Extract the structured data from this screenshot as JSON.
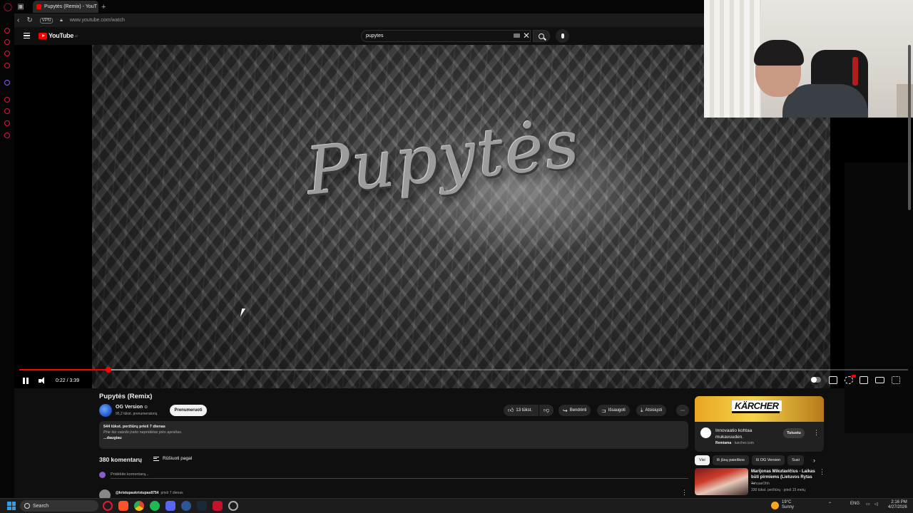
{
  "browser": {
    "tab_title": "Pupytės (Remix) - YouT",
    "url": "www.youtube.com/watch",
    "vpn_label": "VPN",
    "new_tab_icon": "plus-icon"
  },
  "youtube": {
    "logo_text": "YouTube",
    "logo_region": "LT",
    "search_value": "pupytes"
  },
  "video": {
    "overlay_title": "Pupytės",
    "current_time": "0:22",
    "duration": "3:39",
    "time_display": "0:22 / 3:39",
    "progress_fraction": 0.1,
    "buffer_fraction": 0.25,
    "title": "Pupytės (Remix)"
  },
  "channel": {
    "name": "OG Version",
    "subscribers": "95,2 tūkst. prenumeratorių",
    "subscribe_label": "Prenumeruoti"
  },
  "actions": {
    "likes": "13 tūkst.",
    "share": "Bendrinti",
    "save": "Išsaugoti",
    "download": "Atsisiųsti"
  },
  "description": {
    "views_line": "544 tūkst. peržiūrų  prieš 7 dienas",
    "text": "Prie šio vaizdo įrašo nepridėtas joks aprašas.",
    "more": "...daugiau"
  },
  "comments": {
    "count": "380 komentarų",
    "sort_label": "Rūšiuoti pagal",
    "add_placeholder": "Pridėkite komentarą...",
    "first_author": "@kristupaskristupas8754",
    "first_time": "prieš 7 dienas"
  },
  "ad": {
    "brand": "KÄRCHER",
    "headline_line1": "Innovaatio kohtaa",
    "headline_line2": "mukavuuden.",
    "sponsor_label": "Remiama",
    "domain": "karcher.com",
    "cta": "Tutustu"
  },
  "chips": [
    "Visi",
    "Iš jūsų paieškos",
    "Iš OG Version",
    "Susi"
  ],
  "recommendation": {
    "title": "Marijonas Mikutavičius - Laikas būti pirmiems (Lietuvos Rytas ...",
    "channel": "TohuaeOhh",
    "meta": "330 tūkst. peržiūrų · prieš 15 metų",
    "duration": "3:51"
  },
  "taskbar": {
    "search_label": "Search",
    "temperature": "19°C",
    "weather": "Sunny",
    "language": "ENG",
    "time": "2:16 PM",
    "date": "4/27/2026"
  },
  "colors": {
    "youtube_red": "#ff0000",
    "background": "#0f0f0f",
    "opera_red": "#e0183a",
    "windows_blue": "#2aa1f0"
  }
}
